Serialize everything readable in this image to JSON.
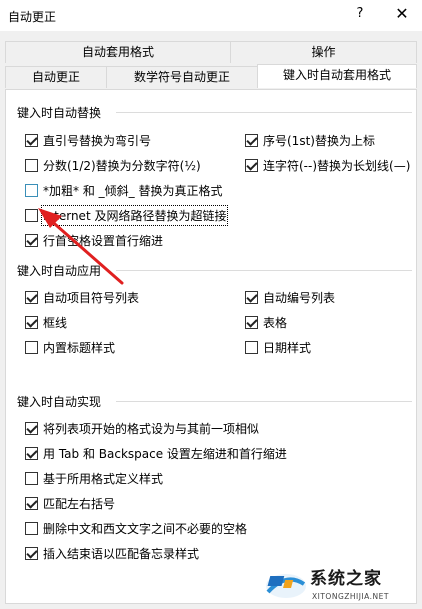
{
  "window": {
    "title": "自动更正",
    "help": "?",
    "close": "✕"
  },
  "tabs_row1": [
    "自动套用格式",
    "操作"
  ],
  "tabs_row2": [
    "自动更正",
    "数学符号自动更正",
    "键入时自动套用格式"
  ],
  "groups": {
    "replace": {
      "title": "键入时自动替换",
      "options": [
        {
          "label": "直引号替换为弯引号",
          "checked": true
        },
        {
          "label": "序号(1st)替换为上标",
          "checked": true
        },
        {
          "label": "分数(1/2)替换为分数字符(½)",
          "checked": false
        },
        {
          "label": "连字符(--)替换为长划线(—)",
          "checked": true
        },
        {
          "label": "*加粗* 和 _倾斜_ 替换为真正格式",
          "checked": false
        },
        {
          "label": "Internet 及网络路径替换为超链接",
          "checked": false
        },
        {
          "label": "行首空格设置首行缩进",
          "checked": true
        }
      ]
    },
    "apply": {
      "title": "键入时自动应用",
      "options": [
        {
          "label": "自动项目符号列表",
          "checked": true
        },
        {
          "label": "自动编号列表",
          "checked": true
        },
        {
          "label": "框线",
          "checked": true
        },
        {
          "label": "表格",
          "checked": true
        },
        {
          "label": "内置标题样式",
          "checked": false
        },
        {
          "label": "日期样式",
          "checked": false
        }
      ]
    },
    "auto": {
      "title": "键入时自动实现",
      "options": [
        {
          "label": "将列表项开始的格式设为与其前一项相似",
          "checked": true
        },
        {
          "label": "用 Tab 和 Backspace 设置左缩进和首行缩进",
          "checked": true
        },
        {
          "label": "基于所用格式定义样式",
          "checked": false
        },
        {
          "label": "匹配左右括号",
          "checked": true
        },
        {
          "label": "删除中文和西文文字之间不必要的空格",
          "checked": false
        },
        {
          "label": "插入结束语以匹配备忘录样式",
          "checked": true
        }
      ]
    }
  },
  "annotation": {
    "arrow_color": "#e02020"
  },
  "watermark": {
    "text": "系统之家",
    "url": "XITONGZHIJIA.NET"
  }
}
